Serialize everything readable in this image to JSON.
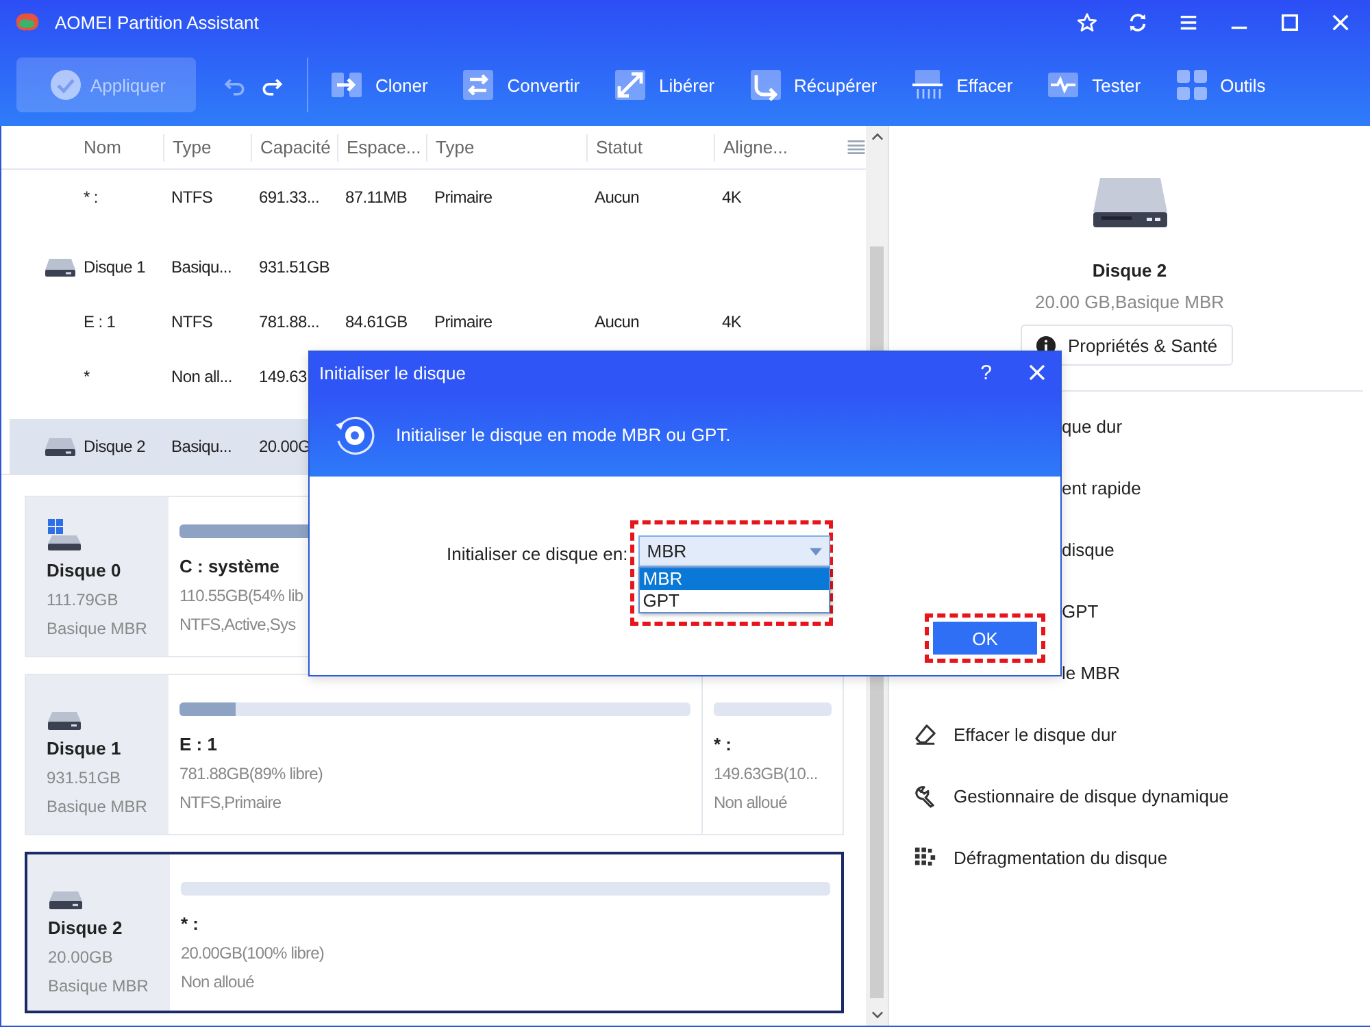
{
  "window": {
    "title": "AOMEI Partition Assistant"
  },
  "toolbar": {
    "apply": {
      "label": "Appliquer",
      "disabled": true
    },
    "undo_disabled": true,
    "tools": [
      "Cloner",
      "Convertir",
      "Libérer",
      "Récupérer",
      "Effacer",
      "Tester",
      "Outils"
    ]
  },
  "table": {
    "columns": [
      "Nom",
      "Type",
      "Capacité",
      "Espace...",
      "Type",
      "Statut",
      "Aligne..."
    ],
    "rows": [
      {
        "kind": "partition",
        "selected": false,
        "cells": [
          "* :",
          "NTFS",
          "691.33...",
          "87.11MB",
          "Primaire",
          "Aucun",
          "4K"
        ]
      },
      {
        "kind": "disk",
        "selected": false,
        "cells": [
          "Disque 1",
          "Basiqu...",
          "931.51GB"
        ]
      },
      {
        "kind": "partition",
        "selected": false,
        "cells": [
          "E : 1",
          "NTFS",
          "781.88...",
          "84.61GB",
          "Primaire",
          "Aucun",
          "4K"
        ]
      },
      {
        "kind": "partition",
        "selected": false,
        "cells": [
          "*",
          "Non all...",
          "149.63"
        ]
      },
      {
        "kind": "disk",
        "selected": true,
        "cells": [
          "Disque 2",
          "Basiqu...",
          "20.00G"
        ]
      }
    ]
  },
  "disk_cards": [
    {
      "kind": "system",
      "name": "Disque 0",
      "size": "111.79GB",
      "type": "Basique MBR",
      "selected": false,
      "partitions": [
        {
          "label": "C : système",
          "detail": "110.55GB(54% lib",
          "info": "NTFS,Active,Sys",
          "level": 0.46
        }
      ]
    },
    {
      "kind": "data",
      "name": "Disque 1",
      "size": "931.51GB",
      "type": "Basique MBR",
      "selected": false,
      "partitions": [
        {
          "label": "E : 1",
          "detail": "781.88GB(89% libre)",
          "info": "NTFS,Primaire",
          "level": 0.11
        },
        {
          "label": "* :",
          "detail": "149.63GB(10...",
          "info": "Non alloué"
        }
      ]
    },
    {
      "kind": "data",
      "name": "Disque 2",
      "size": "20.00GB",
      "type": "Basique MBR",
      "selected": true,
      "partitions": [
        {
          "label": "* :",
          "detail": "20.00GB(100% libre)",
          "info": "Non alloué"
        }
      ]
    }
  ],
  "details": {
    "name": "Disque 2",
    "summary": "20.00 GB,Basique MBR",
    "button": "Propriétés & Santé",
    "actions": [
      {
        "kind": "partial",
        "label": "que dur"
      },
      {
        "kind": "partial",
        "label": "ent rapide"
      },
      {
        "kind": "partial",
        "label": "disque"
      },
      {
        "kind": "partial",
        "label": "GPT"
      },
      {
        "kind": "partial",
        "label": "le MBR"
      },
      {
        "kind": "eraser",
        "label": "Effacer le disque dur"
      },
      {
        "kind": "wrench",
        "label": "Gestionnaire de disque dynamique"
      },
      {
        "kind": "defrag",
        "label": "Défragmentation du disque"
      }
    ]
  },
  "dialog": {
    "title": "Initialiser le disque",
    "help": "?",
    "message": "Initialiser le disque en mode MBR ou GPT.",
    "field_label": "Initialiser ce disque en:",
    "select": {
      "value": "MBR",
      "expanded": true,
      "options": [
        {
          "label": "MBR",
          "selected": true
        },
        {
          "label": "GPT",
          "selected": false
        }
      ]
    },
    "ok": "OK"
  }
}
